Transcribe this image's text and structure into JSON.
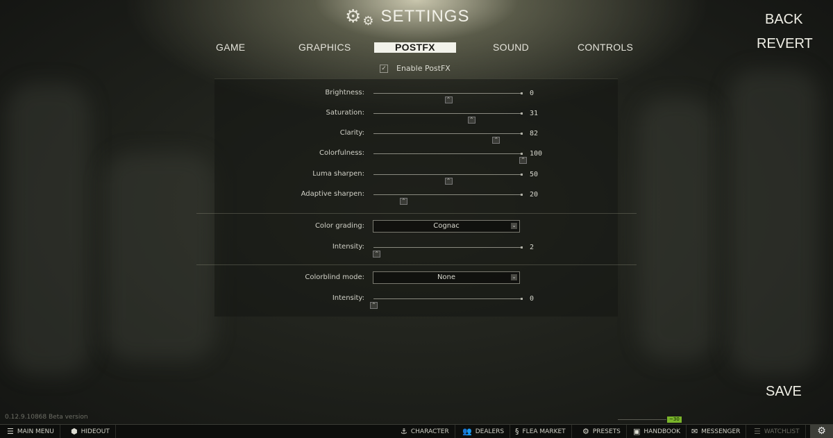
{
  "header": {
    "title": "SETTINGS",
    "back": "BACK",
    "revert": "REVERT",
    "save": "SAVE"
  },
  "tabs": [
    {
      "label": "GAME",
      "active": false
    },
    {
      "label": "GRAPHICS",
      "active": false
    },
    {
      "label": "POSTFX",
      "active": true
    },
    {
      "label": "SOUND",
      "active": false
    },
    {
      "label": "CONTROLS",
      "active": false
    }
  ],
  "enable": {
    "label": "Enable PostFX",
    "checked": true
  },
  "sliders": [
    {
      "label": "Brightness:",
      "value": "0",
      "fraction": 0.5
    },
    {
      "label": "Saturation:",
      "value": "31",
      "fraction": 0.655
    },
    {
      "label": "Clarity:",
      "value": "82",
      "fraction": 0.82
    },
    {
      "label": "Colorfulness:",
      "value": "100",
      "fraction": 1.0
    },
    {
      "label": "Luma sharpen:",
      "value": "50",
      "fraction": 0.5
    },
    {
      "label": "Adaptive sharpen:",
      "value": "20",
      "fraction": 0.2
    }
  ],
  "color_grading": {
    "label": "Color grading:",
    "value": "Cognac"
  },
  "grading_intensity": {
    "label": "Intensity:",
    "value": "2",
    "fraction": 0.02
  },
  "colorblind": {
    "label": "Colorblind mode:",
    "value": "None"
  },
  "colorblind_intensity": {
    "label": "Intensity:",
    "value": "0",
    "fraction": 0.0
  },
  "version": "0.12.9.10868 Beta version",
  "ping": "~30",
  "bottombar": {
    "main_menu": "MAIN MENU",
    "hideout": "HIDEOUT",
    "character": "CHARACTER",
    "dealers": "DEALERS",
    "flea_market": "FLEA MARKET",
    "presets": "PRESETS",
    "handbook": "HANDBOOK",
    "messenger": "MESSENGER",
    "watchlist": "WATCHLIST"
  },
  "colors": {
    "accent_active_tab": "#f2f2ea",
    "ping_green": "#7ab52a",
    "bar_bg": "#0d0e0c"
  }
}
